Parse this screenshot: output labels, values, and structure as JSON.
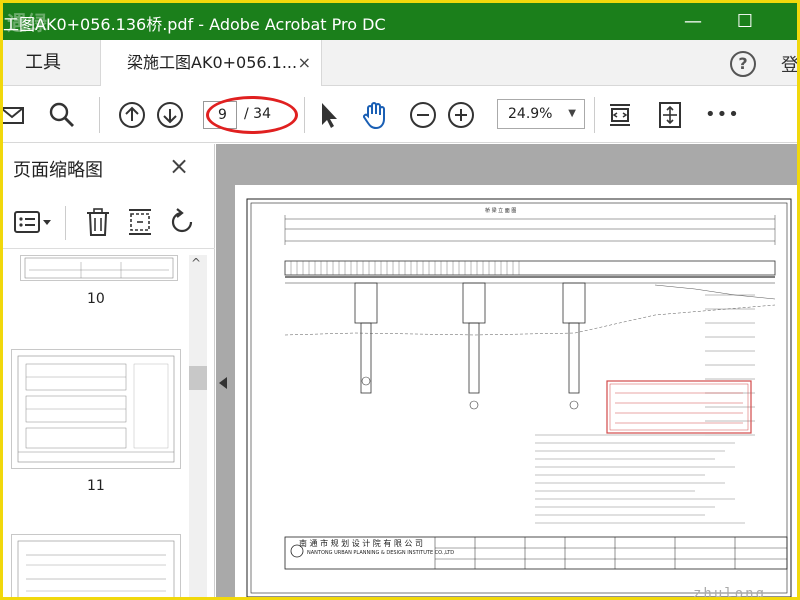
{
  "window": {
    "title": "工图AK0+056.136桥.pdf - Adobe Acrobat Pro DC",
    "watermark_overlay": "遇绿",
    "minimize": "—",
    "maximize": "☐"
  },
  "tabs": {
    "tools_label": "工具",
    "document_label": "梁施工图AK0+056.1...",
    "close_symbol": "×",
    "help_symbol": "?",
    "login_label": "登"
  },
  "toolbar": {
    "current_page": "9",
    "total_pages": "/ 34",
    "zoom": "24.9%",
    "zoom_arrow": "▼",
    "more": "•••"
  },
  "side_panel": {
    "title": "页面缩略图",
    "close_symbol": "×",
    "thumbnails": [
      {
        "label": "10"
      },
      {
        "label": "11"
      },
      {
        "label": ""
      }
    ],
    "scroll_up": "^"
  },
  "document": {
    "section_title": "桥 梁 立 面 图",
    "company_cn": "南 通 市 规 划 设 计 院 有 限 公 司",
    "company_en": "NANTONG URBAN PLANNING & DESIGN INSTITUTE CO.,LTD",
    "stamp_text": "江苏省工程勘察设计出图专用章 南通市规划设计院有限公司",
    "site_watermark": "zhulong"
  },
  "colors": {
    "titlebar": "#1b7f1b",
    "frame_border": "#f1d80c",
    "highlight_oval": "#e02020",
    "workspace": "#a9a9a9",
    "stamp": "#d24a4a"
  }
}
